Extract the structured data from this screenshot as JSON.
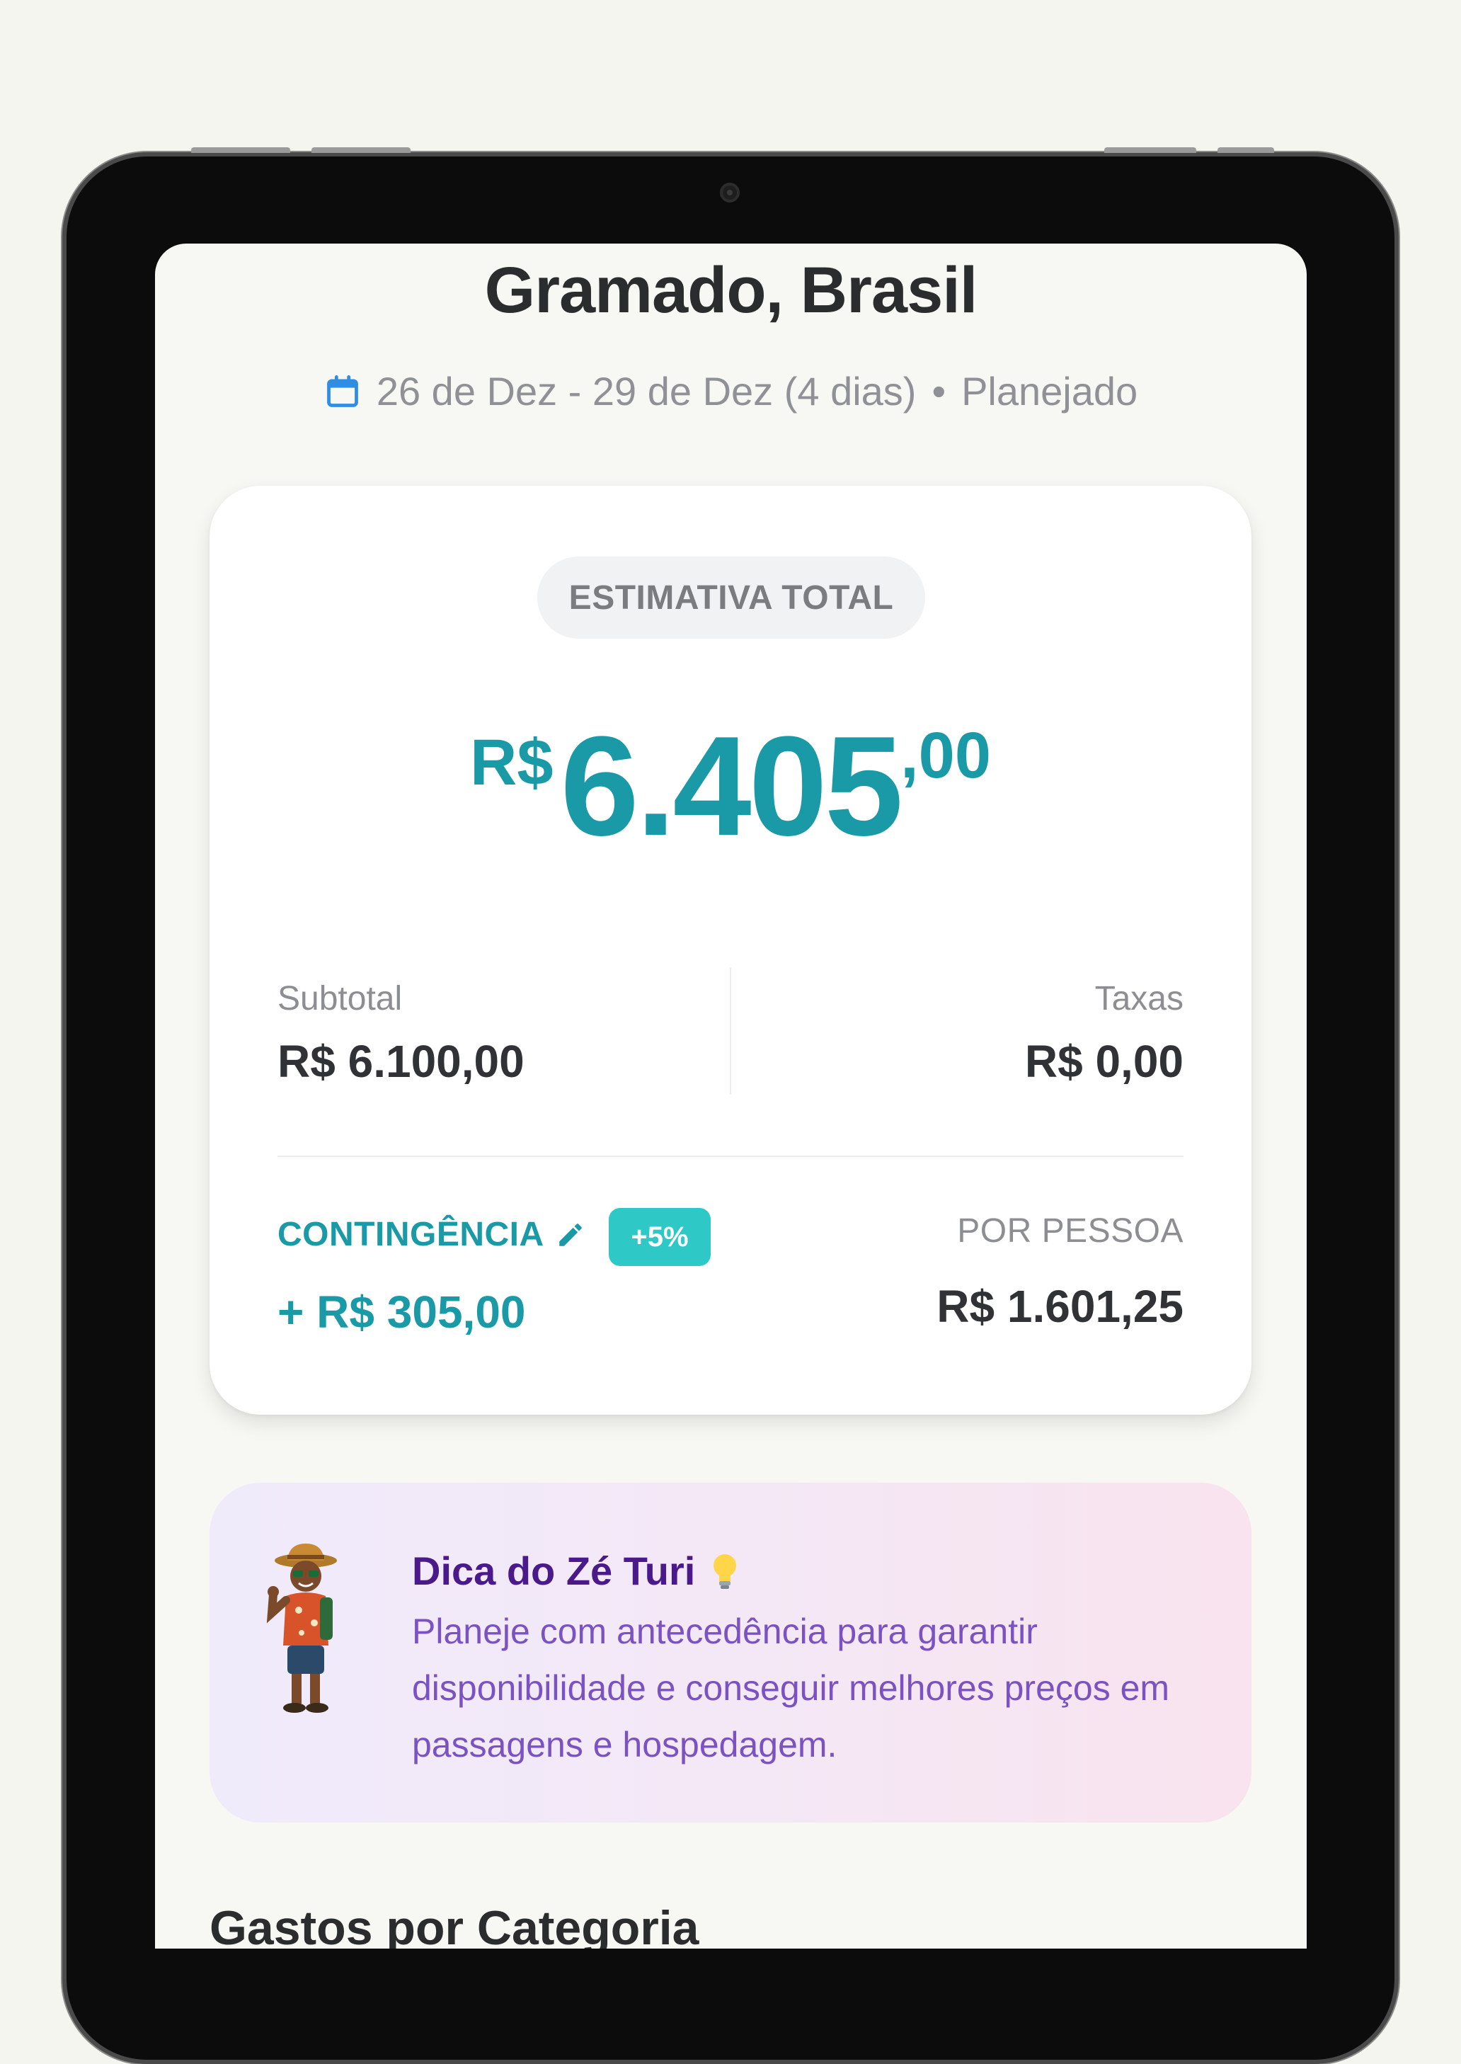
{
  "trip": {
    "title": "Gramado, Brasil",
    "dates": "26 de Dez - 29 de Dez (4 dias)",
    "separator": "•",
    "status": "Planejado"
  },
  "estimate": {
    "chip_label": "ESTIMATIVA TOTAL",
    "currency": "R$",
    "amount_main": "6.405",
    "amount_cents": ",00",
    "subtotal_label": "Subtotal",
    "subtotal_value": "R$ 6.100,00",
    "taxes_label": "Taxas",
    "taxes_value": "R$ 0,00",
    "contingency_label": "CONTINGÊNCIA",
    "contingency_percent": "+5%",
    "contingency_value": "+ R$ 305,00",
    "per_person_label": "POR PESSOA",
    "per_person_value": "R$ 1.601,25"
  },
  "tip": {
    "title": "Dica do Zé Turi",
    "text": "Planeje com antecedência para garantir disponibilidade e conseguir melhores preços em passagens e hospedagem."
  },
  "sections": {
    "categories_title": "Gastos por Categoria"
  },
  "colors": {
    "accent": "#1a9aa6",
    "badge": "#2ec9c6",
    "tip_title": "#4a1a8a",
    "tip_text": "#7a52c2"
  }
}
